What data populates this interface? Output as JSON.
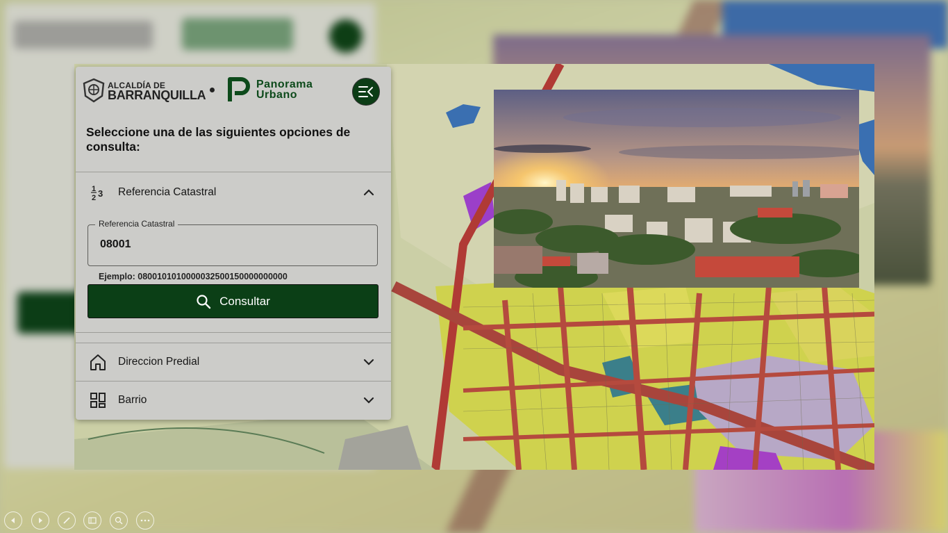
{
  "header": {
    "alcaldia_small": "ALCALDÍA DE",
    "alcaldia_big": "BARRANQUILLA",
    "brand_line1": "Panorama",
    "brand_line2": "Urbano"
  },
  "prompt": "Seleccione una de las siguientes opciones de consulta:",
  "accordion": [
    {
      "label": "Referencia Catastral",
      "icon": "numbers-123-icon",
      "expanded": true
    },
    {
      "label": "Direccion Predial",
      "icon": "home-icon",
      "expanded": false
    },
    {
      "label": "Barrio",
      "icon": "grid-dashboard-icon",
      "expanded": false
    }
  ],
  "form": {
    "field_label": "Referencia Catastral",
    "field_value": "08001",
    "hint": "Ejemplo: 0800101010000032500150000000000",
    "button_label": "Consultar"
  },
  "icons": {
    "menu": "menu-collapse-icon",
    "search": "search-icon",
    "controls": [
      "previous-icon",
      "next-icon",
      "pen-icon",
      "slides-icon",
      "zoom-icon",
      "more-icon"
    ]
  },
  "colors": {
    "primary_green": "#0b3f16",
    "panel_bg": "#ccccc9"
  }
}
